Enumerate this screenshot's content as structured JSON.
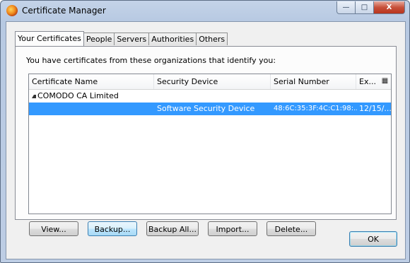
{
  "window": {
    "title": "Certificate Manager",
    "minimize": "—",
    "maximize": "□",
    "close": "X"
  },
  "tabs": [
    "Your Certificates",
    "People",
    "Servers",
    "Authorities",
    "Others"
  ],
  "panel": {
    "intro": "You have certificates from these organizations that identify you:",
    "columns": [
      "Certificate Name",
      "Security Device",
      "Serial Number",
      "Ex..."
    ],
    "groups": [
      {
        "name": "COMODO CA Limited",
        "rows": [
          {
            "name": "",
            "device": "Software Security Device",
            "serial": "48:6C:35:3F:4C:C1:98:...",
            "expires": "12/15/..."
          }
        ]
      }
    ],
    "buttons": [
      "View...",
      "Backup...",
      "Backup All...",
      "Import...",
      "Delete..."
    ]
  },
  "ok_label": "OK"
}
